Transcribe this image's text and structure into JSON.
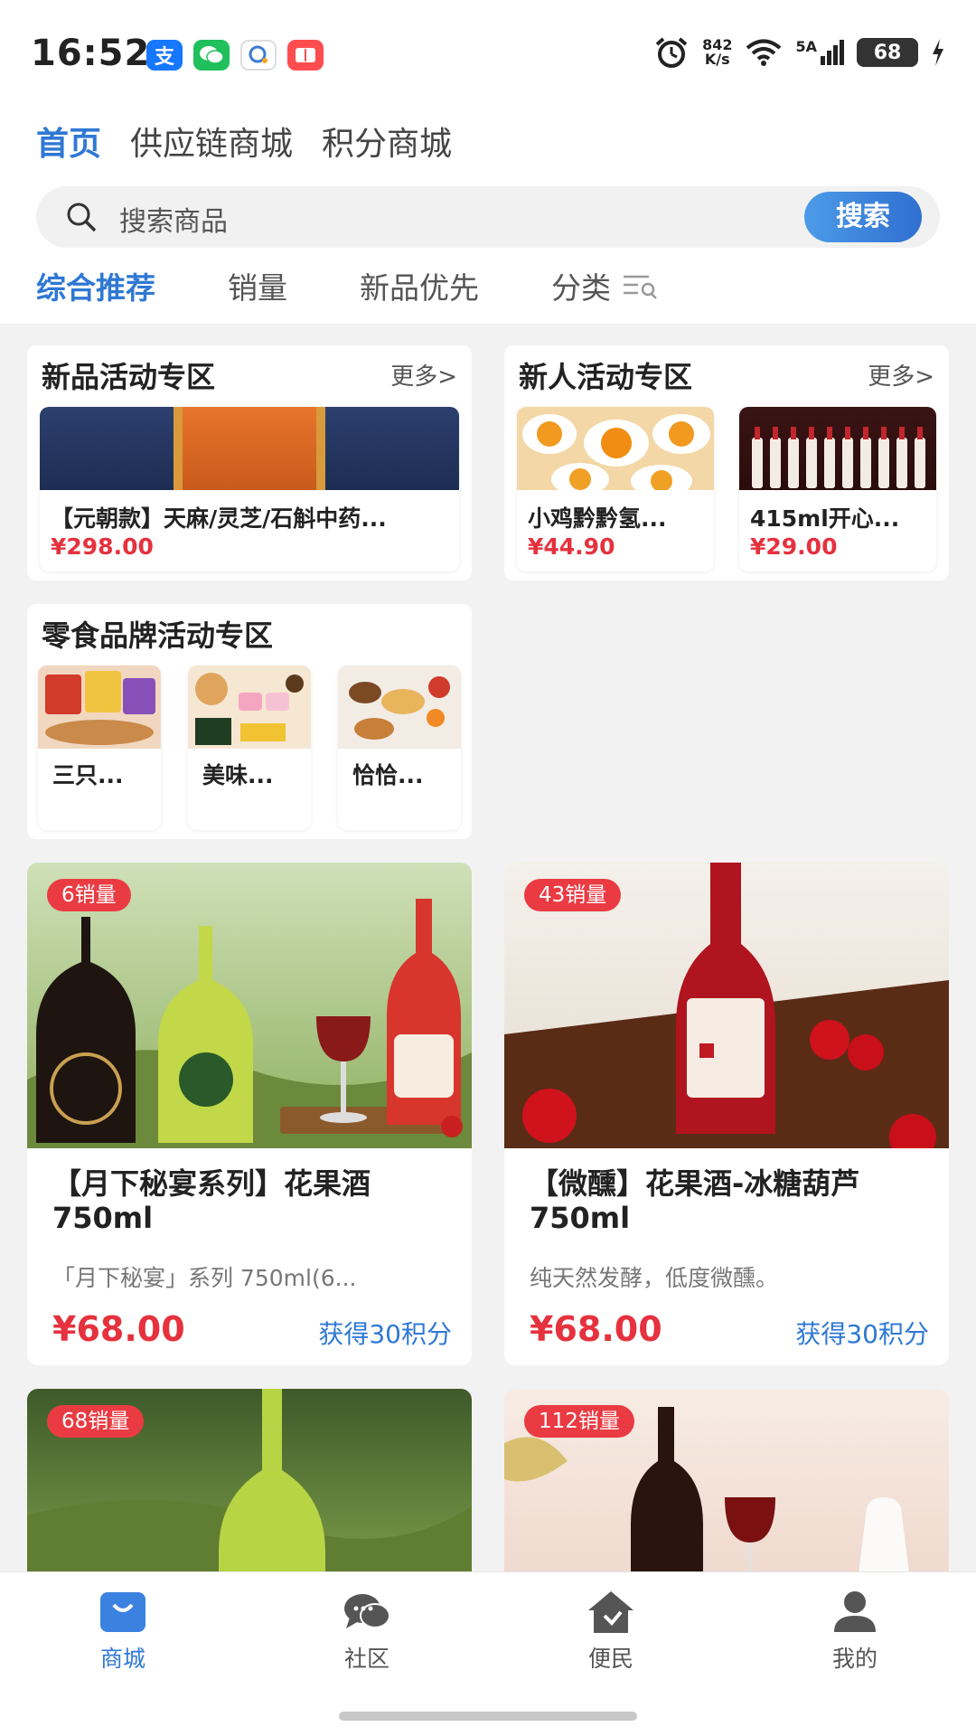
{
  "status_bar": {
    "time": "16:52",
    "app_icons": [
      {
        "name": "alipay-icon",
        "glyph": "支",
        "color": "#1677ff"
      },
      {
        "name": "wechat-icon",
        "glyph": "✉",
        "color": "#20c05c"
      },
      {
        "name": "chat-bubble-icon",
        "glyph": "◎",
        "color": "#ffffff"
      },
      {
        "name": "book-icon",
        "glyph": "▭",
        "color": "#ff4d4f"
      }
    ],
    "net_speed_top": "842",
    "net_speed_bottom": "K/s",
    "signal_label": "5A",
    "battery": "68"
  },
  "header": {
    "top_tabs": [
      "首页",
      "供应链商城",
      "积分商城"
    ],
    "active_top_tab": 0,
    "search_placeholder": "搜索商品",
    "search_button": "搜索",
    "filter_tabs": [
      "综合推荐",
      "销量",
      "新品优先",
      "分类"
    ],
    "active_filter_tab": 0
  },
  "zones": {
    "new_product": {
      "title": "新品活动专区",
      "more": "更多>",
      "item": {
        "name": "【元朝款】天麻/灵芝/石斛中药...",
        "price": "¥298.00"
      }
    },
    "newcomer": {
      "title": "新人活动专区",
      "more": "更多>",
      "items": [
        {
          "name": "小鸡黔黔氢...",
          "price": "¥44.90"
        },
        {
          "name": "415ml开心...",
          "price": "¥29.00"
        }
      ]
    },
    "snack": {
      "title": "零食品牌活动专区",
      "items": [
        {
          "name": "三只..."
        },
        {
          "name": "美味..."
        },
        {
          "name": "恰恰..."
        }
      ]
    }
  },
  "products": [
    {
      "sales": "6销量",
      "title": "【月下秘宴系列】花果酒750ml",
      "desc": "「月下秘宴」系列 750ml(6...",
      "price": "¥68.00",
      "points": "获得30积分"
    },
    {
      "sales": "43销量",
      "title": "【微醺】花果酒-冰糖葫芦750ml",
      "desc": "纯天然发酵，低度微醺。",
      "price": "¥68.00",
      "points": "获得30积分"
    },
    {
      "sales": "68销量"
    },
    {
      "sales": "112销量"
    }
  ],
  "bottom_nav": [
    {
      "label": "商城",
      "icon": "shopping-bag-icon"
    },
    {
      "label": "社区",
      "icon": "chat-bubbles-icon"
    },
    {
      "label": "便民",
      "icon": "home-service-icon"
    },
    {
      "label": "我的",
      "icon": "user-icon"
    }
  ],
  "colors": {
    "accent": "#2f78d4",
    "price": "#e5323e",
    "badge": "#ea3b43"
  }
}
